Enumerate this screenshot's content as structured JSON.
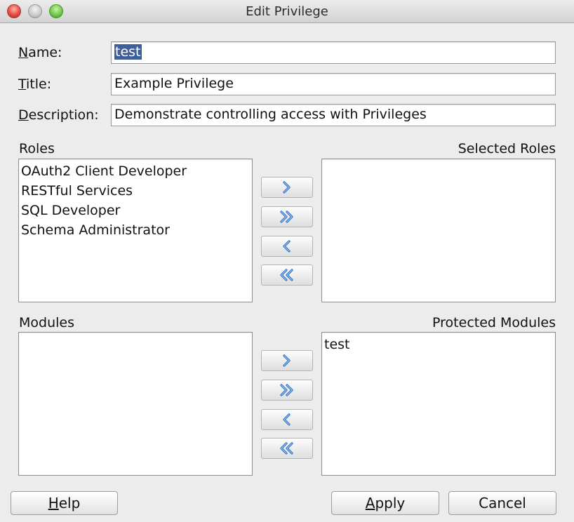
{
  "window": {
    "title": "Edit Privilege"
  },
  "form": {
    "name": {
      "label_mnemonic": "N",
      "label_rest": "ame:",
      "value": "test"
    },
    "title": {
      "label_mnemonic": "T",
      "label_rest": "itle:",
      "value": "Example Privilege"
    },
    "description": {
      "label_mnemonic": "D",
      "label_rest": "escription:",
      "value": "Demonstrate controlling access with Privileges"
    }
  },
  "roles": {
    "available_label": "Roles",
    "selected_label": "Selected Roles",
    "available": [
      "OAuth2 Client Developer",
      "RESTful Services",
      "SQL Developer",
      "Schema Administrator"
    ],
    "selected": []
  },
  "modules": {
    "available_label": "Modules",
    "protected_label": "Protected Modules",
    "available": [],
    "protected": [
      "test"
    ]
  },
  "shuttle_icons": {
    "add": "chevron-right-icon",
    "add_all": "double-chevron-right-icon",
    "remove": "chevron-left-icon",
    "remove_all": "double-chevron-left-icon"
  },
  "buttons": {
    "help_mnemonic": "H",
    "help_rest": "elp",
    "apply_mnemonic": "A",
    "apply_rest": "pply",
    "cancel": "Cancel"
  },
  "colors": {
    "accent": "#3a7fd5",
    "selection": "#3f5f98"
  }
}
